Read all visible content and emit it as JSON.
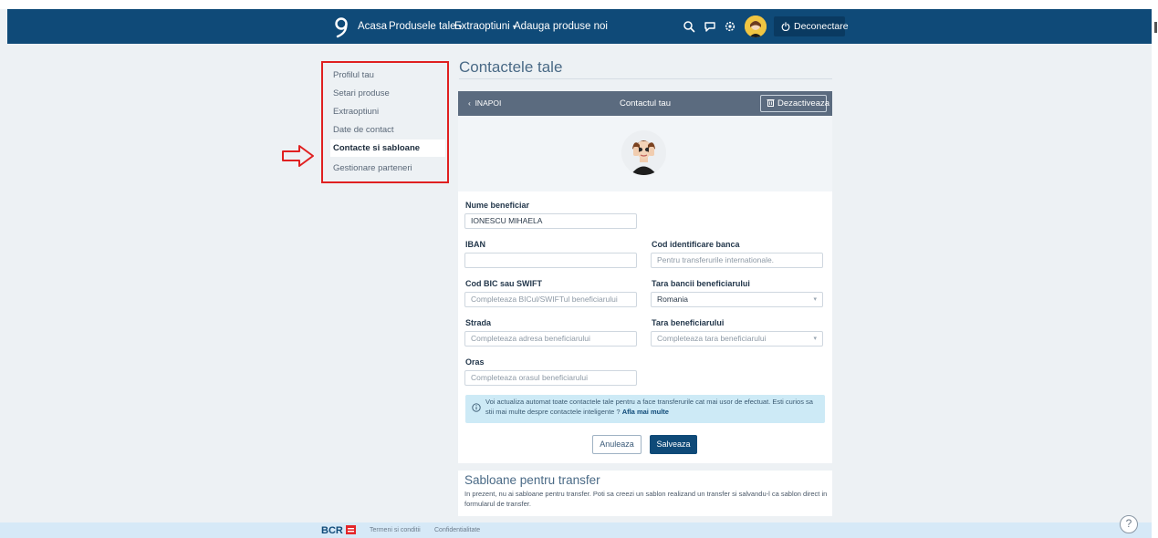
{
  "nav": {
    "items": [
      {
        "label": "Acasa",
        "dropdown": false
      },
      {
        "label": "Produsele tale",
        "dropdown": true
      },
      {
        "label": "Extraoptiuni",
        "dropdown": true
      },
      {
        "label": "Adauga produse noi",
        "dropdown": false
      }
    ],
    "logout_label": "Deconectare",
    "icons": [
      "search-icon",
      "chat-icon",
      "settings-icon"
    ],
    "bg_color": "#0f4a78"
  },
  "sidebar": {
    "items": [
      {
        "label": "Profilul tau",
        "active": false
      },
      {
        "label": "Setari produse",
        "active": false
      },
      {
        "label": "Extraoptiuni",
        "active": false
      },
      {
        "label": "Date de contact",
        "active": false
      },
      {
        "label": "Contacte si sabloane",
        "active": true
      },
      {
        "label": "Gestionare parteneri",
        "active": false
      }
    ],
    "highlight_color": "#e02020"
  },
  "page": {
    "title": "Contactele tale"
  },
  "card": {
    "back_label": "INAPOI",
    "header_title": "Contactul tau",
    "deactivate_label": "Dezactiveaza"
  },
  "form": {
    "name_label": "Nume beneficiar",
    "name_value": "IONESCU MIHAELA",
    "iban_label": "IBAN",
    "iban_value": "",
    "bank_code_label": "Cod identificare banca",
    "bank_code_placeholder": "Pentru transferurile internationale.",
    "bic_label": "Cod BIC sau SWIFT",
    "bic_placeholder": "Completeaza BICul/SWIFTul beneficiarului",
    "bank_country_label": "Tara bancii beneficiarului",
    "bank_country_value": "Romania",
    "street_label": "Strada",
    "street_placeholder": "Completeaza adresa beneficiarului",
    "country_label": "Tara beneficiarului",
    "country_placeholder": "Completeaza tara beneficiarului",
    "city_label": "Oras",
    "city_placeholder": "Completeaza orasul beneficiarului"
  },
  "info": {
    "text": "Voi actualiza automat toate contactele tale pentru a face transferurile cat mai usor de efectuat. Esti curios sa stii mai multe despre contactele inteligente ?",
    "link": "Afla mai multe"
  },
  "actions": {
    "cancel_label": "Anuleaza",
    "save_label": "Salveaza"
  },
  "templates": {
    "title": "Sabloane pentru transfer",
    "text": "In prezent, nu ai sabloane pentru transfer. Poti sa creezi un sablon realizand un transfer si salvandu-l ca sablon direct in formularul de transfer."
  },
  "footer": {
    "brand": "BCR",
    "links": [
      "Termeni si conditii",
      "Confidentialitate"
    ],
    "help_label": "?"
  }
}
